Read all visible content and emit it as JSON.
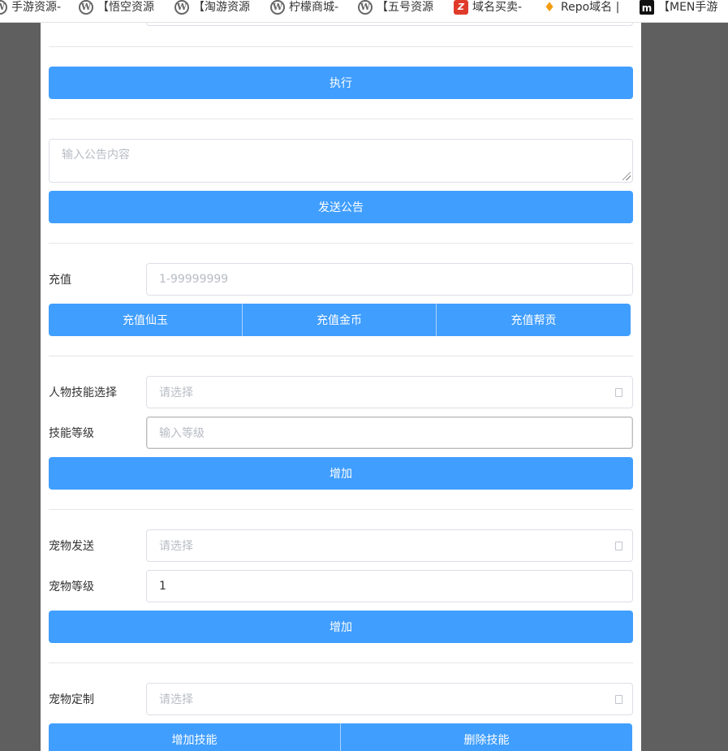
{
  "bookmarks": [
    {
      "icon": "wordpress-icon",
      "label": "手游资源-"
    },
    {
      "icon": "wordpress-icon",
      "label": "【悟空资源"
    },
    {
      "icon": "wordpress-icon",
      "label": "【淘游资源"
    },
    {
      "icon": "wordpress-icon",
      "label": "柠檬商城-"
    },
    {
      "icon": "wordpress-icon",
      "label": "【五号资源"
    },
    {
      "icon": "domain-red-icon",
      "label": "域名买卖-"
    },
    {
      "icon": "repo-orange-icon",
      "label": "Repo域名 |"
    },
    {
      "icon": "men-black-icon",
      "label": "【MEN手游"
    }
  ],
  "execute": {
    "label": "执行"
  },
  "announcement": {
    "placeholder": "输入公告内容",
    "send_label": "发送公告"
  },
  "recharge": {
    "label": "充值",
    "placeholder": "1-99999999",
    "buttons": [
      "充值仙玉",
      "充值金币",
      "充值帮贡"
    ]
  },
  "skill": {
    "select_label": "人物技能选择",
    "select_placeholder": "请选择",
    "level_label": "技能等级",
    "level_placeholder": "输入等级",
    "add_label": "增加"
  },
  "pet_send": {
    "select_label": "宠物发送",
    "select_placeholder": "请选择",
    "level_label": "宠物等级",
    "level_value": "1",
    "add_label": "增加"
  },
  "pet_custom": {
    "select_label": "宠物定制",
    "select_placeholder": "请选择",
    "buttons": [
      "增加技能",
      "删除技能"
    ]
  },
  "colors": {
    "primary": "#409eff",
    "backdrop": "#5f5f5f"
  }
}
